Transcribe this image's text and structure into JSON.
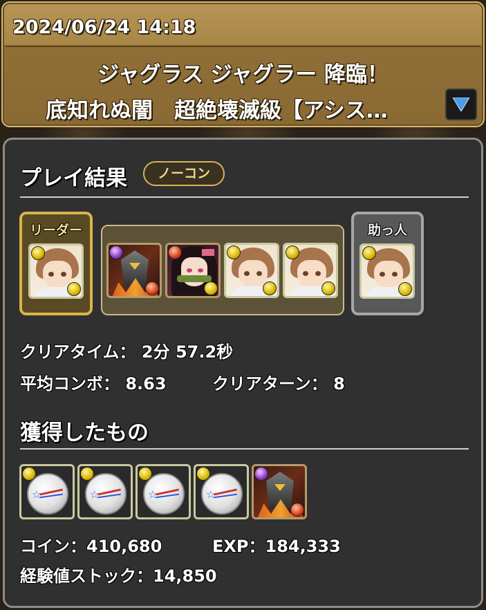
{
  "header": {
    "datetime": "2024/06/24 14:18",
    "title_line1": "ジャグラス ジャグラー 降臨！",
    "title_line2": "底知れぬ闇　超絶壊滅級【アシス…"
  },
  "result": {
    "title": "プレイ結果",
    "badge": "ノーコン",
    "leader_label": "リーダー",
    "helper_label": "助っ人",
    "team": [
      {
        "name": "girl-card",
        "attribute_main": "light"
      },
      {
        "name": "demon-card",
        "attribute_main": "dark",
        "attribute_sub": "fire"
      },
      {
        "name": "nezuko-card",
        "attribute_main": "fire",
        "attribute_sub": "light"
      },
      {
        "name": "girl-card",
        "attribute_main": "light"
      },
      {
        "name": "girl-card",
        "attribute_main": "light"
      },
      {
        "name": "girl-card",
        "attribute_main": "light"
      }
    ],
    "clear_time_label": "クリアタイム：",
    "clear_time_value": "2分 57.2秒",
    "avg_combo_label": "平均コンボ：",
    "avg_combo_value": "8.63",
    "clear_turn_label": "クリアターン：",
    "clear_turn_value": "8"
  },
  "rewards": {
    "title": "獲得したもの",
    "items": [
      {
        "name": "orb-item",
        "attribute": "light"
      },
      {
        "name": "orb-item",
        "attribute": "light"
      },
      {
        "name": "orb-item",
        "attribute": "light"
      },
      {
        "name": "orb-item",
        "attribute": "light"
      },
      {
        "name": "demon-item",
        "attribute_main": "dark",
        "attribute_sub": "fire"
      }
    ],
    "coin_label": "コイン：",
    "coin_value": "410,680",
    "exp_label": "EXP：",
    "exp_value": "184,333",
    "stock_label": "経験値ストック：",
    "stock_value": "14,850"
  },
  "colors": {
    "header_gold": "#a88748",
    "panel_bg": "#303030",
    "leader_border": "#d8b44a",
    "badge_text": "#f2d88a"
  }
}
